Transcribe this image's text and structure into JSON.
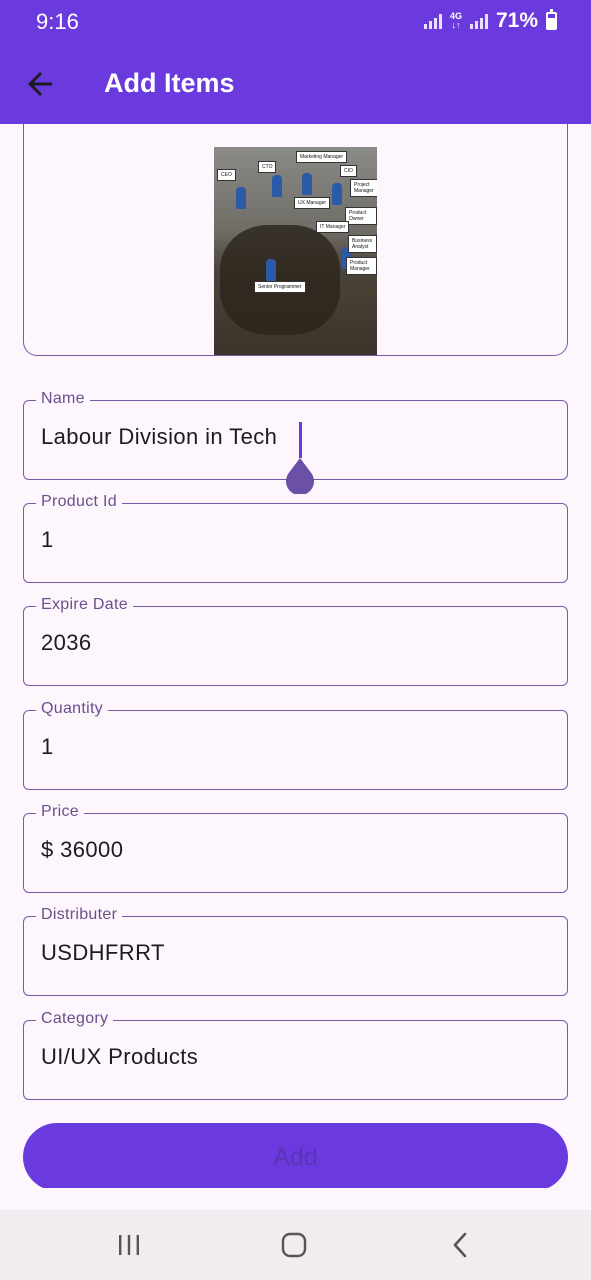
{
  "status_bar": {
    "time": "9:16",
    "network": "4G",
    "battery": "71%"
  },
  "app_bar": {
    "title": "Add Items"
  },
  "form": {
    "name": {
      "label": "Name",
      "value": "Labour Division in Tech"
    },
    "product_id": {
      "label": "Product Id",
      "value": "1"
    },
    "expire_date": {
      "label": "Expire Date",
      "value": "2036"
    },
    "quantity": {
      "label": "Quantity",
      "value": "1"
    },
    "price": {
      "label": "Price",
      "value": "$ 36000"
    },
    "distributer": {
      "label": "Distributer",
      "value": "USDHFRRT"
    },
    "category": {
      "label": "Category",
      "value": "UI/UX Products"
    }
  },
  "image_labels": [
    "CEO",
    "CTO",
    "Marketing Manager",
    "CIO",
    "Project Manager",
    "UX Manager",
    "Product Owner",
    "IT Manager",
    "Business Analyst",
    "Product Manager",
    "Senior Programmer"
  ],
  "add_button": {
    "label": "Add"
  },
  "colors": {
    "primary": "#6b3ade",
    "outline": "#7a5aa6",
    "background": "#fdf6fd",
    "label": "#6a4f8c"
  },
  "nav_icons": [
    "recent-apps-icon",
    "home-icon",
    "back-icon"
  ]
}
